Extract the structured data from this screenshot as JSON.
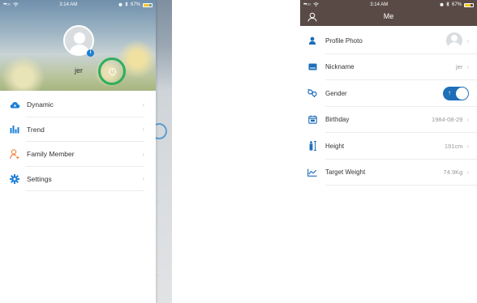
{
  "left": {
    "status": {
      "carrier": "•••○○",
      "time": "3:14 AM",
      "battery": "67%"
    },
    "profile": {
      "username": "jer"
    },
    "menu": [
      {
        "label": "Dynamic",
        "icon": "cloud-icon"
      },
      {
        "label": "Trend",
        "icon": "bar-chart-icon"
      },
      {
        "label": "Family Member",
        "icon": "family-member-icon"
      },
      {
        "label": "Settings",
        "icon": "gear-icon"
      }
    ]
  },
  "right": {
    "status": {
      "carrier": "•••○○",
      "time": "3:14 AM",
      "battery": "67%"
    },
    "title": "Me",
    "rows": [
      {
        "label": "Profile Photo",
        "value": ""
      },
      {
        "label": "Nickname",
        "value": "jer"
      },
      {
        "label": "Gender",
        "value": ""
      },
      {
        "label": "Birthday",
        "value": "1984-08-29"
      },
      {
        "label": "Height",
        "value": "191cm"
      },
      {
        "label": "Target Weight",
        "value": "74.9Kg"
      }
    ]
  },
  "colors": {
    "accent_blue": "#1e6fb8",
    "nav_brown": "#5a4a45",
    "highlight_green": "#2fae5a",
    "icon_orange": "#f08a4b"
  }
}
